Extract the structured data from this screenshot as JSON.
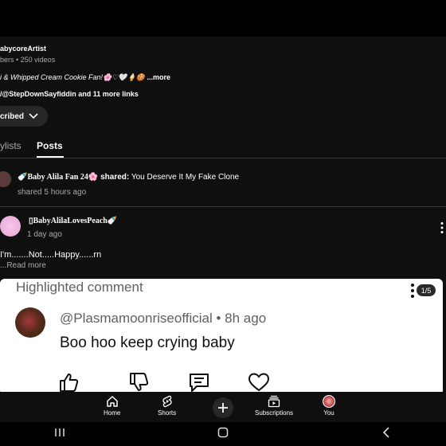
{
  "channel": {
    "handle": "abycoreArtist",
    "meta": "bers • 250 videos",
    "description_italic": "i & Whipped Cream Cookie Fan!🌸♡🤍🍦🍪",
    "description_more": "...more",
    "links": "/@StepDownSayfiddin and 11 more links",
    "subscribed_label": "cribed"
  },
  "tabs": {
    "playlists": "ylists",
    "posts": "Posts"
  },
  "shared_post": {
    "author": "🍼Baby Alila Fan 24🌸",
    "action": "shared:",
    "title": "You Deserve It My Fake Clone",
    "time": "shared 5 hours ago"
  },
  "post": {
    "author": "▯BabyAlilaLovesPeach🍼",
    "time": "1 day ago",
    "text": "I'm.......Not.....Happy......rn",
    "read_more": "...Read more"
  },
  "highlighted": {
    "title": "Highlighted comment",
    "counter": "1/5",
    "author": "@Plasmamoonriseofficial",
    "time": "• 8h ago",
    "text": "Boo hoo keep crying baby"
  },
  "bottom_nav": {
    "home": "Home",
    "shorts": "Shorts",
    "subscriptions": "Subscriptions",
    "you": "You"
  },
  "colors": {
    "background": "#0f0f0f",
    "card": "#ffffff",
    "muted": "#aaaaaa"
  }
}
